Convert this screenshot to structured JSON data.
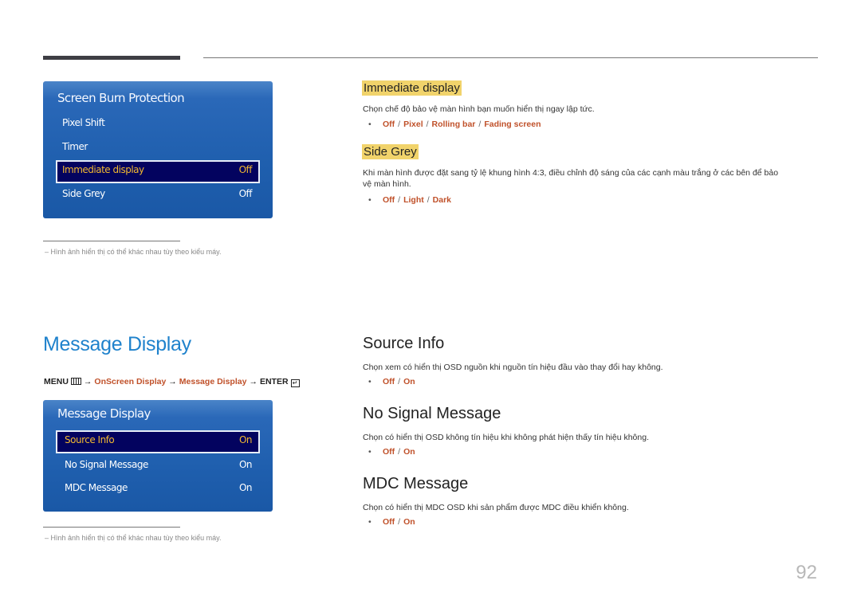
{
  "osd_panels": {
    "screen_burn": {
      "title": "Screen Burn Protection",
      "items": [
        {
          "label": "Pixel Shift",
          "value": ""
        },
        {
          "label": "Timer",
          "value": ""
        },
        {
          "label": "Immediate display",
          "value": "Off"
        },
        {
          "label": "Side Grey",
          "value": "Off"
        }
      ]
    },
    "message_display": {
      "title": "Message Display",
      "items": [
        {
          "label": "Source Info",
          "value": "On"
        },
        {
          "label": "No Signal Message",
          "value": "On"
        },
        {
          "label": "MDC Message",
          "value": "On"
        }
      ]
    }
  },
  "notes": {
    "image_note": "Hình ảnh hiển thị có thể khác nhau tùy theo kiểu máy.",
    "dash": "–"
  },
  "sections_top": {
    "immediate_display": {
      "heading": "Immediate display",
      "description": "Chọn chế độ bảo vệ màn hình bạn muốn hiển thị ngay lập tức.",
      "options": [
        "Off",
        "Pixel",
        "Rolling bar",
        "Fading screen"
      ]
    },
    "side_grey": {
      "heading": "Side Grey",
      "description_line1": "Khi màn hình được đặt sang tỷ lệ khung hình 4:3, điều chỉnh độ sáng của các cạnh màu trắng ở các bên để bảo",
      "description_line2": "vệ màn hình.",
      "options": [
        "Off",
        "Light",
        "Dark"
      ]
    }
  },
  "message_display": {
    "page_title": "Message Display",
    "path": {
      "menu": "MENU",
      "arrow": "→",
      "step1": "OnScreen Display",
      "step2": "Message Display",
      "enter": "ENTER",
      "enter_glyph": "↵"
    },
    "source_info": {
      "heading": "Source Info",
      "description": "Chọn xem có hiển thị OSD nguồn khi nguồn tín hiệu đầu vào thay đổi hay không.",
      "options": [
        "Off",
        "On"
      ]
    },
    "no_signal": {
      "heading": "No Signal Message",
      "description": "Chọn có hiển thị OSD không tín hiệu khi không phát hiện thấy tín hiệu không.",
      "options": [
        "Off",
        "On"
      ]
    },
    "mdc_message": {
      "heading": "MDC Message",
      "description": "Chọn có hiển thị MDC OSD khi sản phẩm được MDC điều khiển không.",
      "options": [
        "Off",
        "On"
      ]
    }
  },
  "bullet": "•",
  "separator": "/",
  "page_number": "92",
  "colors": {
    "osd_blue": "#1f5fae",
    "osd_selected_bg": "#03035f",
    "osd_selected_text": "#f2b830",
    "highlight": "#f1d36b",
    "option_orange": "#c0512a",
    "title_blue": "#1f82cc"
  }
}
